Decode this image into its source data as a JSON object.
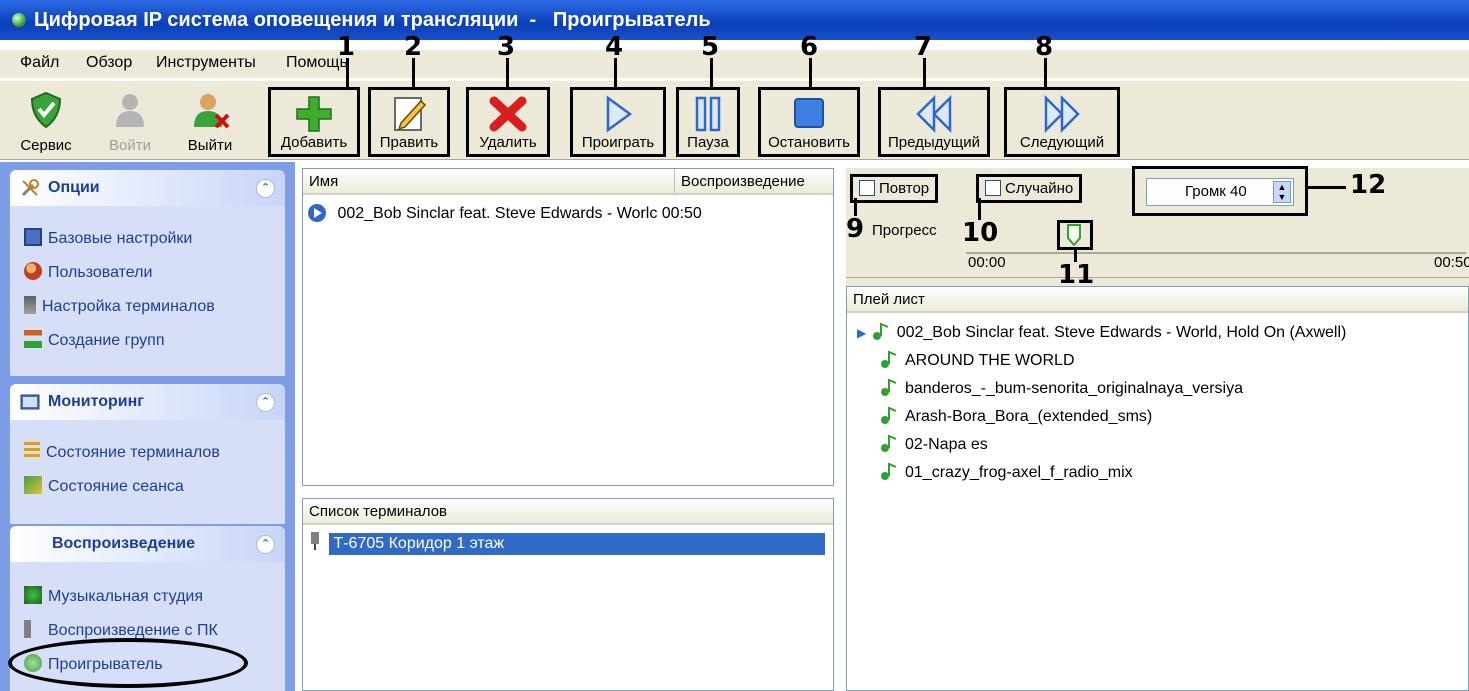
{
  "window": {
    "title": "Цифровая IP система оповещения и трансляции  -   Проигрыватель"
  },
  "menu": [
    "Файл",
    "Обзор",
    "Инструменты",
    "Помощь"
  ],
  "toolbar": {
    "service": "Сервис",
    "login": "Войти",
    "logout": "Выйти",
    "add": "Добавить",
    "edit": "Править",
    "delete": "Удалить",
    "play": "Проиграть",
    "pause": "Пауза",
    "stop": "Остановить",
    "prev": "Предыдущий",
    "next": "Следующий"
  },
  "callouts": [
    "1",
    "2",
    "3",
    "4",
    "5",
    "6",
    "7",
    "8",
    "9",
    "10",
    "11",
    "12"
  ],
  "sidebar": {
    "options": {
      "title": "Опции",
      "items": [
        "Базовые настройки",
        "Пользователи",
        "Настройка терминалов",
        "Создание групп"
      ]
    },
    "monitoring": {
      "title": "Мониторинг",
      "items": [
        "Состояние терминалов",
        "Состояние сеанса"
      ]
    },
    "playback": {
      "title": "Воспроизведение",
      "items": [
        "Музыкальная студия",
        "Воспроизведение с ПК",
        "Проигрыватель"
      ]
    }
  },
  "tracks": {
    "col_name": "Имя",
    "col_play": "Воспроизведение",
    "rows": [
      {
        "name": "002_Bob Sinclar feat. Steve Edwards - Worlc",
        "time": "00:50"
      }
    ]
  },
  "terminals": {
    "header": "Список терминалов",
    "rows": [
      "Т-6705 Коридор 1 этаж"
    ]
  },
  "controls": {
    "repeat": "Повтор",
    "shuffle": "Случайно",
    "volume": "Громк 40",
    "progress_label": "Прогресс",
    "time_start": "00:00",
    "time_end": "00:50",
    "progress_value": 0.0
  },
  "playlist": {
    "header": "Плей лист",
    "items": [
      "002_Bob Sinclar feat. Steve Edwards - World, Hold On (Axwell)",
      "AROUND THE WORLD",
      "banderos_-_bum-senorita_originalnaya_versiya",
      "Arash-Bora_Bora_(extended_sms)",
      "02-Napa es",
      "01_crazy_frog-axel_f_radio_mix"
    ]
  },
  "colors": {
    "titlebar": "#0a3fb7",
    "sidebar": "#7d9ee6",
    "selection": "#316ac5",
    "accent": "#1c3f94"
  }
}
